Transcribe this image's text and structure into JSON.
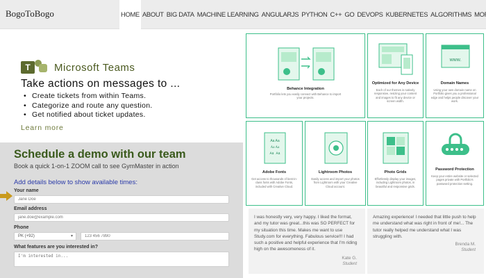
{
  "brand": "BogoToBogo",
  "nav": {
    "items": [
      "HOME",
      "ABOUT",
      "BIG DATA",
      "MACHINE LEARNING",
      "ANGULARJS",
      "PYTHON",
      "C++",
      "GO",
      "DEVOPS",
      "KUBERNETES",
      "ALGORITHMS"
    ],
    "more": "MORE...",
    "active": "HOME"
  },
  "ad_teams": {
    "product": "Microsoft Teams",
    "heading": "Take actions on messages to ...",
    "bullets": [
      "Create tickets from within Teams.",
      "Categorize and route any question.",
      "Get notified about ticket updates."
    ],
    "learn_more": "Learn more"
  },
  "demo_form": {
    "title": "Schedule a demo with our team",
    "subtitle": "Book a quick 1-on-1 ZOOM call to see GymMaster in action",
    "add_details": "Add details below to show available times:",
    "name_label": "Your name",
    "name_placeholder": "Jane Doe",
    "email_label": "Email address",
    "email_placeholder": "jane.doe@example.com",
    "phone_label": "Phone",
    "country_value": "PK (+92)",
    "phone_placeholder": "123 456 7890",
    "features_label": "What features are you interested in?",
    "features_placeholder": "I'm interested in..."
  },
  "features": [
    {
      "title": "Behance Integration",
      "desc": "Portfolio lets you easily connect with Behance to import your projects.",
      "icon": "sync-arrows-icon"
    },
    {
      "title": "Optimized for Any Device",
      "desc": "Each of our themes is natively responsive, resizing your content and images to fit any device or screen width.",
      "icon": "devices-icon"
    },
    {
      "title": "Domain Names",
      "desc": "Using your own domain name on Portfolio gives you a professional edge and helps people discover your work.",
      "icon": "www-window-icon"
    },
    {
      "title": "Adobe Fonts",
      "desc": "Get access to thousands of best-in-class fonts with Adobe Fonts, included with Creative Cloud.",
      "icon": "fonts-page-icon"
    },
    {
      "title": "Lightroom Photos",
      "desc": "Easily access and import your photos from Lightroom with your Creative Cloud account.",
      "icon": "lightroom-photos-icon"
    },
    {
      "title": "Photo Grids",
      "desc": "Effortlessly display your images, including Lightroom photos, in beautiful and responsive grids.",
      "icon": "photo-grid-icon"
    },
    {
      "title": "Password Protection",
      "desc": "Keep your entire website or selected pages private with Portfolio's password protection setting.",
      "icon": "password-lock-icon"
    }
  ],
  "testimonials": [
    {
      "text": "I was honestly very, very happy. I liked the format, and my tutor was great...this was SO PERFECT for my situation this time. Makes me want to use Study.com for everything. Fabulous service!!! I had such a positive and helpful experience that I'm riding high on the awesomeness of it.",
      "name": "Kate G.",
      "role": "Student"
    },
    {
      "text": "Amazing experience! I needed that little push to help me understand what was right in front of me!... The tutor really helped me understand what I was struggling with.",
      "name": "Brenda M.",
      "role": "Student"
    }
  ],
  "colors": {
    "accent_green": "#3dbf8a",
    "demo_title": "#3a5a1c",
    "link_blue": "#2a3aa8",
    "arrow": "#c99a1d"
  }
}
